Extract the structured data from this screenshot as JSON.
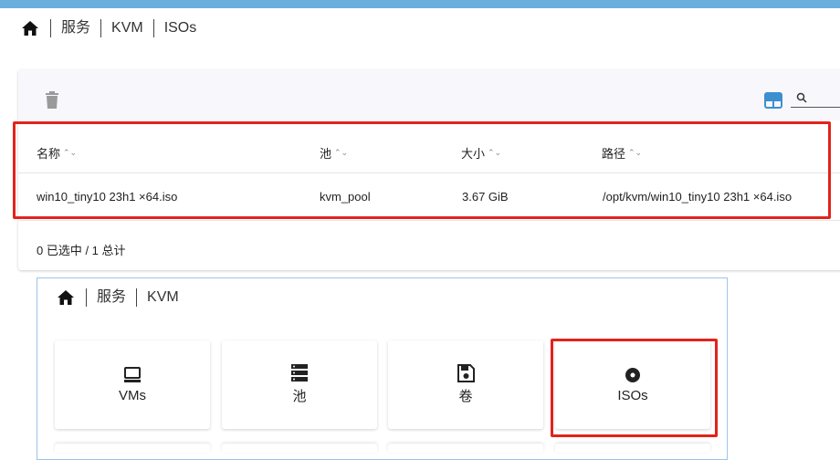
{
  "breadcrumb_top": {
    "items": [
      "服务",
      "KVM",
      "ISOs"
    ]
  },
  "table": {
    "columns": [
      {
        "label": "名称"
      },
      {
        "label": "池"
      },
      {
        "label": "大小"
      },
      {
        "label": "路径"
      }
    ],
    "rows": [
      {
        "name": "win10_tiny10 23h1 ×64.iso",
        "pool": "kvm_pool",
        "size": "3.67 GiB",
        "path": "/opt/kvm/win10_tiny10 23h1 ×64.iso"
      }
    ],
    "footer": "0 已选中 / 1 总计"
  },
  "breadcrumb_panel": {
    "items": [
      "服务",
      "KVM"
    ]
  },
  "tiles": [
    {
      "label": "VMs",
      "icon": "monitor-icon"
    },
    {
      "label": "池",
      "icon": "server-icon"
    },
    {
      "label": "卷",
      "icon": "floppy-disk-icon"
    },
    {
      "label": "ISOs",
      "icon": "disc-icon"
    }
  ],
  "colors": {
    "accent": "#6aaedd",
    "highlight": "#e3221b",
    "panel_border": "#9cc3ea"
  }
}
